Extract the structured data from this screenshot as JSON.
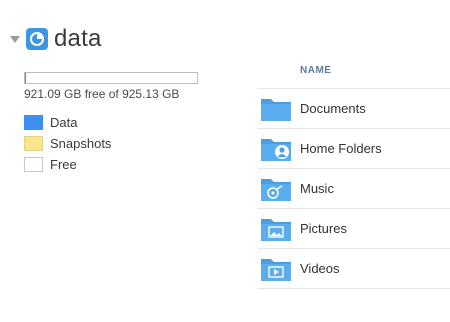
{
  "volume": {
    "name": "data",
    "capacity_text": "921.09 GB free of 925.13 GB",
    "used_fraction_data": 0.004,
    "used_fraction_snapshots": 0.0
  },
  "legend": [
    {
      "label": "Data",
      "color": "#3d8ff0"
    },
    {
      "label": "Snapshots",
      "color": "#fbe58a"
    },
    {
      "label": "Free",
      "color": "#ffffff"
    }
  ],
  "list": {
    "header": "NAME",
    "items": [
      {
        "label": "Documents",
        "icon": "documents-folder-icon"
      },
      {
        "label": "Home Folders",
        "icon": "home-folders-icon"
      },
      {
        "label": "Music",
        "icon": "music-folder-icon"
      },
      {
        "label": "Pictures",
        "icon": "pictures-folder-icon"
      },
      {
        "label": "Videos",
        "icon": "videos-folder-icon"
      }
    ]
  },
  "colors": {
    "accent": "#3d97e0",
    "folder": "#4a9fe4"
  }
}
